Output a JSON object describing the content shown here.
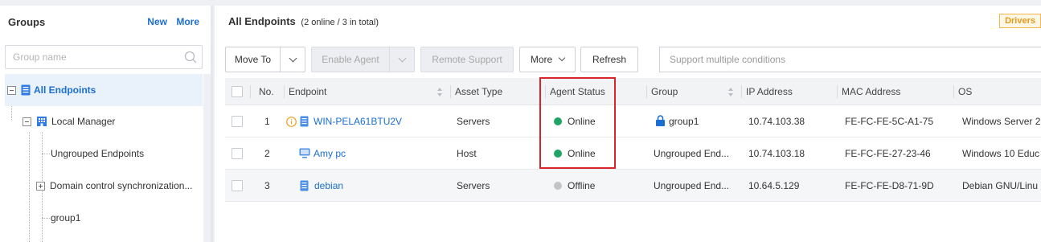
{
  "sidebar": {
    "title": "Groups",
    "new_label": "New",
    "more_label": "More",
    "search_placeholder": "Group name",
    "tree": [
      {
        "label": "All Endpoints"
      },
      {
        "label": "Local Manager"
      },
      {
        "label": "Ungrouped Endpoints"
      },
      {
        "label": "Domain control synchronization..."
      },
      {
        "label": "group1"
      }
    ]
  },
  "main": {
    "title": "All Endpoints",
    "subtitle": "(2 online / 3 in total)",
    "drivers_label": "Drivers"
  },
  "toolbar": {
    "move_to": "Move To",
    "enable_agent": "Enable Agent",
    "remote_support": "Remote Support",
    "more": "More",
    "refresh": "Refresh",
    "filter_placeholder": "Support multiple conditions"
  },
  "table": {
    "headers": {
      "no": "No.",
      "endpoint": "Endpoint",
      "asset_type": "Asset Type",
      "agent_status": "Agent Status",
      "group": "Group",
      "ip": "IP Address",
      "mac": "MAC Address",
      "os": "OS"
    },
    "rows": [
      {
        "no": "1",
        "endpoint": "WIN-PELA61BTU2V",
        "asset_type": "Servers",
        "status": "Online",
        "group": "group1",
        "ip": "10.74.103.38",
        "mac": "FE-FC-FE-5C-A1-75",
        "os": "Windows Server 2"
      },
      {
        "no": "2",
        "endpoint": "Amy pc",
        "asset_type": "Host",
        "status": "Online",
        "group": "Ungrouped End...",
        "ip": "10.74.103.18",
        "mac": "FE-FC-FE-27-23-46",
        "os": "Windows 10 Educ"
      },
      {
        "no": "3",
        "endpoint": "debian",
        "asset_type": "Servers",
        "status": "Offline",
        "group": "Ungrouped End...",
        "ip": "10.64.5.129",
        "mac": "FE-FC-FE-D8-71-9D",
        "os": "Debian GNU/Linu"
      }
    ]
  },
  "colors": {
    "accent": "#1b6fd1",
    "online": "#1fa463",
    "offline": "#c4c4c4",
    "highlight_box": "#d8242a",
    "warning": "#f0a020"
  },
  "icons": [
    "search-icon",
    "all-endpoints-icon",
    "local-manager-icon",
    "info-icon",
    "server-icon",
    "host-icon",
    "lock-icon",
    "chevron-down-icon"
  ]
}
